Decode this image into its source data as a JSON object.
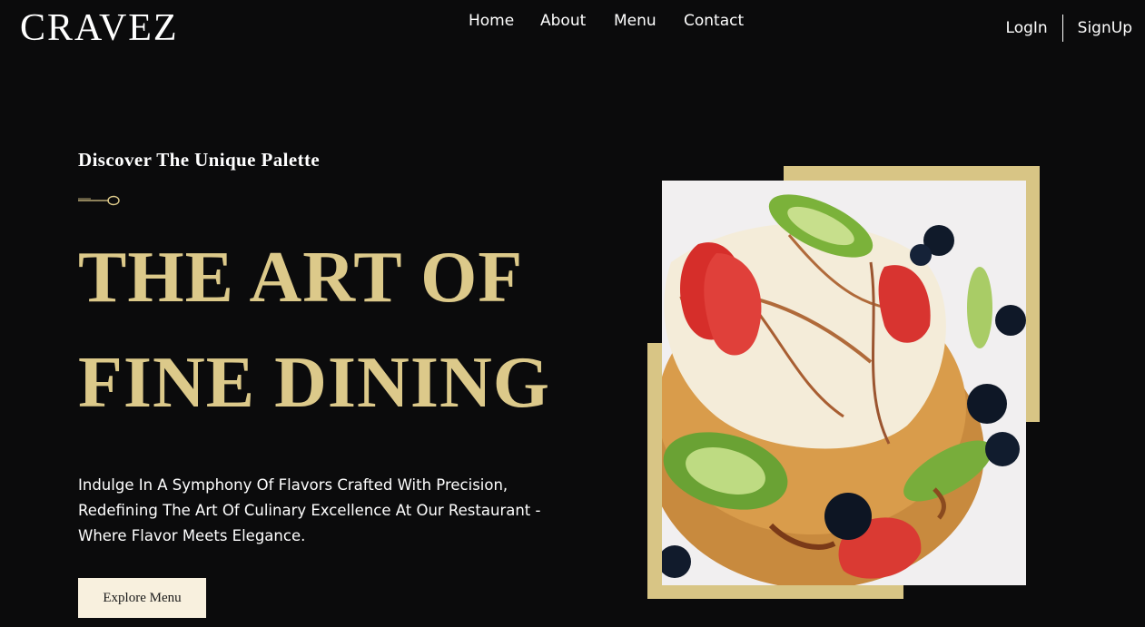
{
  "brand": {
    "logo": "CRAVEZ"
  },
  "nav": {
    "items": [
      "Home",
      "About",
      "Menu",
      "Contact"
    ]
  },
  "auth": {
    "login": "LogIn",
    "signup": "SignUp"
  },
  "hero": {
    "eyebrow": "Discover The Unique Palette",
    "headline": [
      "THE ART OF",
      "FINE DINING"
    ],
    "description": "Indulge In A Symphony Of Flavors Crafted With Precision, Redefining The Art Of Culinary Excellence At Our Restaurant - Where Flavor Meets Elegance.",
    "cta": "Explore Menu"
  },
  "colors": {
    "background": "#0b0b0c",
    "accent_gold": "#dcc98a",
    "frame_gold": "#d8c585",
    "button_bg": "#f8f0de",
    "text": "#ffffff"
  },
  "icons": {
    "divider": "spoon-icon"
  }
}
